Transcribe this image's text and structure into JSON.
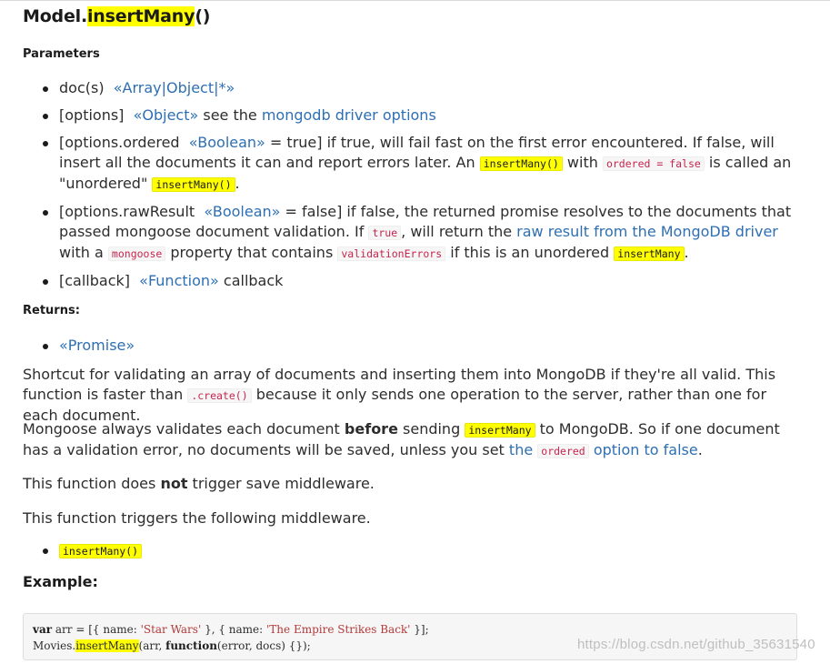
{
  "title": {
    "prefix": "Model.",
    "highlight": "insertMany",
    "suffix": "()"
  },
  "parameters_label": "Parameters",
  "params": [
    {
      "name": "doc(s)",
      "types": "«Array|Object|*»"
    },
    {
      "name": "[options]",
      "types": "«Object»",
      "text1": " see the ",
      "link": "mongodb driver options"
    },
    {
      "name": "[options.ordered",
      "types": "«Boolean»",
      "text1": " = true] if true, will fail fast on the first error encountered. If false, will insert all the documents it can and report errors later. An ",
      "code1": "insertMany()",
      "text2": " with ",
      "code2": "ordered = false",
      "text3": " is called an \"unordered\" ",
      "code3": "insertMany()",
      "text4": "."
    },
    {
      "name": "[options.rawResult",
      "types": "«Boolean»",
      "text1": " = false] if false, the returned promise resolves to the documents that passed mongoose document validation. If ",
      "code1": "true",
      "text2": ", will return the ",
      "link": "raw result from the MongoDB driver",
      "text3": " with a ",
      "code2": "mongoose",
      "text4": " property that contains ",
      "code3": "validationErrors",
      "text5": " if this is an unordered ",
      "code4": "insertMany",
      "text6": "."
    },
    {
      "name": "[callback]",
      "types": "«Function»",
      "text1": " callback"
    }
  ],
  "returns_label": "Returns:",
  "returns": "«Promise»",
  "para1": {
    "text1": "Shortcut for validating an array of documents and inserting them into MongoDB if they're all valid. This function is faster than ",
    "code": ".create()",
    "text2": " because it only sends one operation to the server, rather than one for each document."
  },
  "para2": {
    "text1": "Mongoose always validates each document ",
    "bold": "before",
    "text2": " sending ",
    "code": "insertMany",
    "text3": " to MongoDB. So if one document has a validation error, no documents will be saved, unless you set ",
    "link1": "the ",
    "link_code": "ordered",
    "link2": " option to false",
    "text4": "."
  },
  "para3": {
    "text1": "This function does ",
    "bold": "not",
    "text2": " trigger save middleware."
  },
  "para4": "This function triggers the following middleware.",
  "middleware": [
    "insertMany()"
  ],
  "example_label": "Example:",
  "example_code": {
    "line1_kw": "var",
    "line1_a": " arr = [{ name: ",
    "line1_s1": "'Star Wars'",
    "line1_b": " }, { name: ",
    "line1_s2": "'The Empire Strikes Back'",
    "line1_c": " }];",
    "line2_a": "Movies.",
    "line2_hl": "insertMany",
    "line2_b": "(arr, ",
    "line2_kw": "function",
    "line2_c": "(error, docs) {});"
  },
  "watermark": "https://blog.csdn.net/github_35631540"
}
